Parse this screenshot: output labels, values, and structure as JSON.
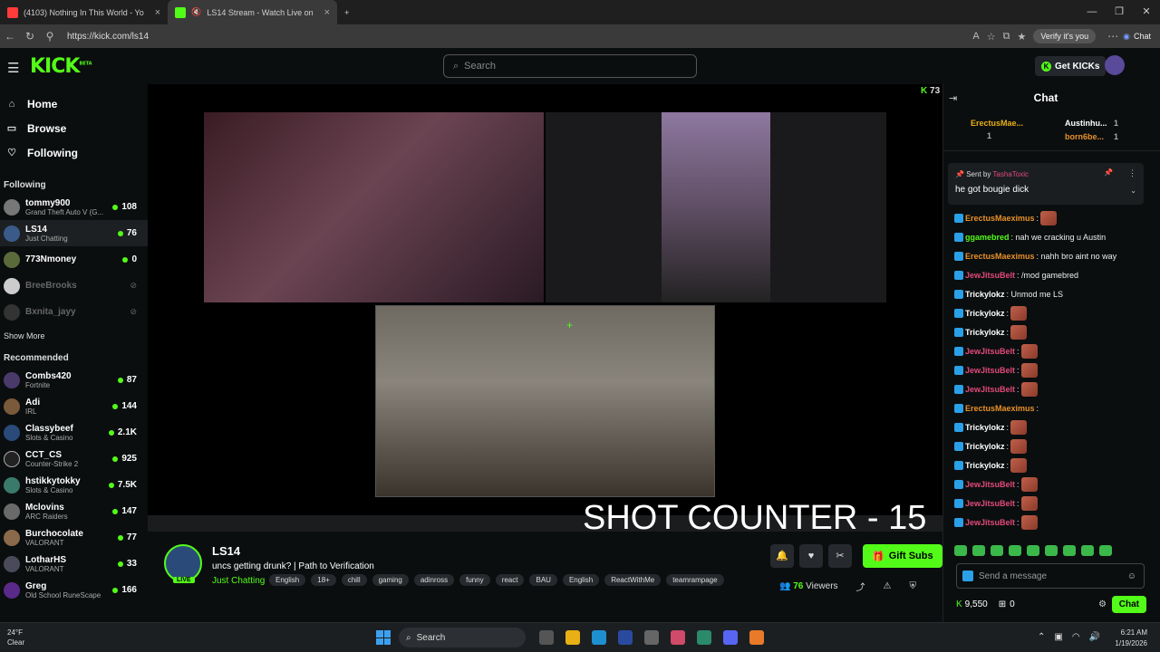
{
  "browser": {
    "tabs": [
      {
        "label": "(4103) Nothing In This World - Yo",
        "color": "#ff3b3b"
      },
      {
        "label": "LS14 Stream - Watch Live on",
        "color": "#53fc18"
      }
    ],
    "url": "https://kick.com/ls14",
    "verify_label": "Verify it's you",
    "chat_label": "Chat"
  },
  "header": {
    "logo": "KICK",
    "beta": "BETA",
    "search_placeholder": "Search",
    "get_kicks": "Get KICKs"
  },
  "sidebar": {
    "nav": [
      {
        "label": "Home",
        "icon": "home-icon"
      },
      {
        "label": "Browse",
        "icon": "browse-icon"
      },
      {
        "label": "Following",
        "icon": "heart-icon"
      }
    ],
    "following_title": "Following",
    "following": [
      {
        "name": "tommy900",
        "game": "Grand Theft Auto V (G...",
        "viewers": "108"
      },
      {
        "name": "LS14",
        "game": "Just Chatting",
        "viewers": "76"
      },
      {
        "name": "773Nmoney",
        "game": "",
        "viewers": "0"
      },
      {
        "name": "BreeBrooks",
        "game": "",
        "viewers": ""
      },
      {
        "name": "Bxnita_jayy",
        "game": "",
        "viewers": ""
      }
    ],
    "show_more": "Show More",
    "recommended_title": "Recommended",
    "recommended": [
      {
        "name": "Combs420",
        "game": "Fortnite",
        "viewers": "87"
      },
      {
        "name": "Adi",
        "game": "IRL",
        "viewers": "144"
      },
      {
        "name": "Classybeef",
        "game": "Slots & Casino",
        "viewers": "2.1K"
      },
      {
        "name": "CCT_CS",
        "game": "Counter-Strike 2",
        "viewers": "925"
      },
      {
        "name": "hstikkytokky",
        "game": "Slots & Casino",
        "viewers": "7.5K"
      },
      {
        "name": "Mclovins",
        "game": "ARC Raiders",
        "viewers": "147"
      },
      {
        "name": "Burchocolate",
        "game": "VALORANT",
        "viewers": "77"
      },
      {
        "name": "LotharHS",
        "game": "VALORANT",
        "viewers": "33"
      },
      {
        "name": "Greg",
        "game": "Old School RuneScape",
        "viewers": "166"
      }
    ]
  },
  "player": {
    "overlay_text": "SHOT COUNTER - 15",
    "viewer_badge": "73"
  },
  "stream": {
    "streamer": "LS14",
    "live_label": "LIVE",
    "title": "uncs getting drunk? | Path to Verification",
    "category": "Just Chatting",
    "tags": [
      "English",
      "18+",
      "chill",
      "gaming",
      "adinross",
      "funny",
      "react",
      "BAU",
      "English",
      "ReactWithMe",
      "teamrampage"
    ],
    "gift_label": "Gift Subs",
    "viewers": "76",
    "viewers_label": "Viewers"
  },
  "chat": {
    "title": "Chat",
    "leaderboard": [
      {
        "name": "ErectusMae...",
        "count": "1"
      },
      {
        "name": "Austinhu...",
        "count": "1"
      },
      {
        "name": "born6be...",
        "count": "1"
      }
    ],
    "pinned": {
      "sent_by": "Sent by",
      "user": "TashaToxic",
      "message": "he got bougie dick"
    },
    "messages": [
      {
        "user": "ErectusMaeximus",
        "color": "#e8912a",
        "text": ":",
        "emote": true
      },
      {
        "user": "ggamebred",
        "color": "#53fc18",
        "text": ": nah we cracking u Austin",
        "emote": false
      },
      {
        "user": "ErectusMaeximus",
        "color": "#e8912a",
        "text": ": nahh bro aint no way",
        "emote": false
      },
      {
        "user": "JewJitsuBelt",
        "color": "#e04a7a",
        "text": ": /mod gamebred",
        "emote": false
      },
      {
        "user": "Trickylokz",
        "color": "#fff",
        "text": ": Unmod me LS",
        "emote": false
      },
      {
        "user": "Trickylokz",
        "color": "#fff",
        "text": ":",
        "emote": true
      },
      {
        "user": "Trickylokz",
        "color": "#fff",
        "text": ":",
        "emote": true
      },
      {
        "user": "JewJitsuBelt",
        "color": "#e04a7a",
        "text": ":",
        "emote": true
      },
      {
        "user": "JewJitsuBelt",
        "color": "#e04a7a",
        "text": ":",
        "emote": true
      },
      {
        "user": "JewJitsuBelt",
        "color": "#e04a7a",
        "text": ":",
        "emote": true
      },
      {
        "user": "ErectusMaeximus",
        "color": "#e8912a",
        "text": ":",
        "emote": false
      },
      {
        "user": "Trickylokz",
        "color": "#fff",
        "text": ":",
        "emote": true
      },
      {
        "user": "Trickylokz",
        "color": "#fff",
        "text": ":",
        "emote": true
      },
      {
        "user": "Trickylokz",
        "color": "#fff",
        "text": ":",
        "emote": true
      },
      {
        "user": "JewJitsuBelt",
        "color": "#e04a7a",
        "text": ":",
        "emote": true
      },
      {
        "user": "JewJitsuBelt",
        "color": "#e04a7a",
        "text": ":",
        "emote": true
      },
      {
        "user": "JewJitsuBelt",
        "color": "#e04a7a",
        "text": ":",
        "emote": true
      }
    ],
    "input_placeholder": "Send a message",
    "kicks_balance": "9,550",
    "gift_count": "0",
    "send_label": "Chat"
  },
  "taskbar": {
    "temp": "24°F",
    "weather": "Clear",
    "search_label": "Search",
    "time": "6:21 AM",
    "date": "1/19/2026"
  }
}
